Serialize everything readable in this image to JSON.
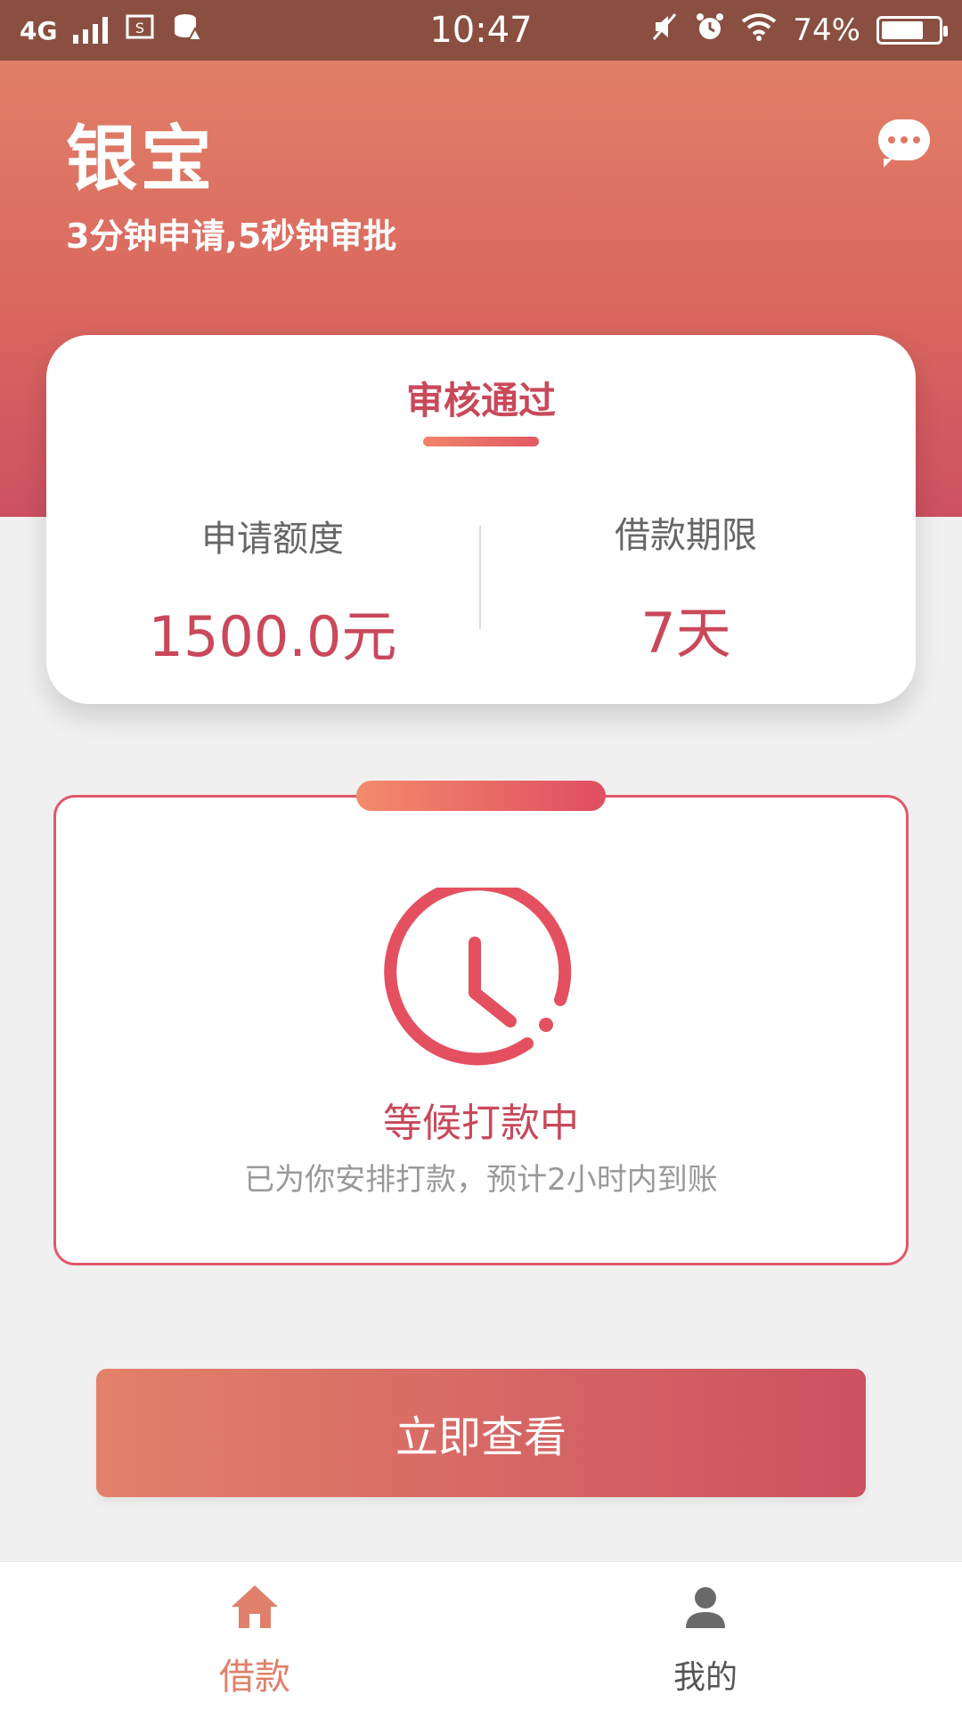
{
  "status_bar": {
    "network": "4G",
    "time": "10:47",
    "battery": "74%",
    "battery_level": 0.74,
    "icons": [
      "signal-icon",
      "screenshot-icon",
      "data-icon",
      "mute-icon",
      "alarm-icon",
      "wifi-icon",
      "battery-icon"
    ]
  },
  "header": {
    "title": "银宝",
    "subtitle": "3分钟申请,5秒钟审批",
    "chat_icon": "chat-bubble-icon"
  },
  "summary": {
    "status": "审核通过",
    "amount_label": "申请额度",
    "amount_value": "1500.0元",
    "term_label": "借款期限",
    "term_value": "7天"
  },
  "waiting": {
    "icon": "clock-icon",
    "title": "等候打款中",
    "description": "已为你安排打款，预计2小时内到账"
  },
  "cta": {
    "label": "立即查看"
  },
  "bottom_nav": {
    "items": [
      {
        "label": "借款",
        "icon": "home-icon",
        "active": true
      },
      {
        "label": "我的",
        "icon": "user-icon",
        "active": false
      }
    ]
  },
  "colors": {
    "accent": "#c9485a",
    "header_top": "#e17f67",
    "header_bottom": "#cd5061",
    "active_nav": "#e0806a",
    "status_bar": "#8a4f40"
  }
}
